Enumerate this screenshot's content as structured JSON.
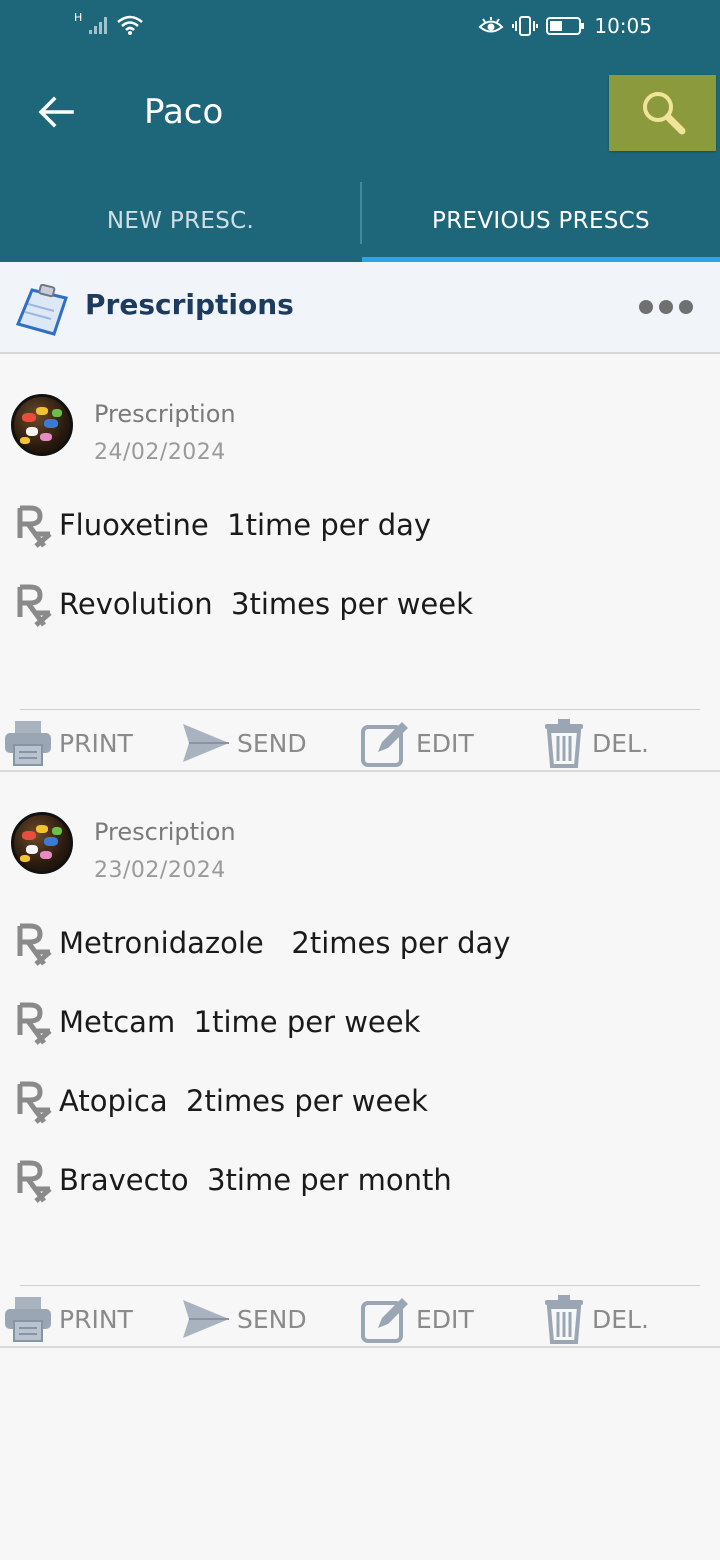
{
  "status_bar": {
    "time": "10:05",
    "network": "H"
  },
  "header": {
    "title": "Paco"
  },
  "tabs": [
    {
      "label": "NEW PRESC.",
      "selected": false
    },
    {
      "label": "PREVIOUS PRESCS",
      "selected": true
    }
  ],
  "section": {
    "title": "Prescriptions"
  },
  "prescriptions": [
    {
      "label": "Prescription",
      "date": "24/02/2024",
      "medications": [
        "Fluoxetine  1time per day",
        "Revolution  3times per week"
      ]
    },
    {
      "label": "Prescription",
      "date": "23/02/2024",
      "medications": [
        "Metronidazole   2times per day",
        "Metcam  1time per week",
        "Atopica  2times per week",
        "Bravecto  3time per month"
      ]
    }
  ],
  "actions": {
    "print": "PRINT",
    "send": "SEND",
    "edit": "EDIT",
    "delete": "DEL."
  },
  "colors": {
    "primary": "#1e677b",
    "search_button": "#8b9a3d",
    "tab_indicator": "#2aa5e6",
    "section_title": "#1d3b5e"
  }
}
